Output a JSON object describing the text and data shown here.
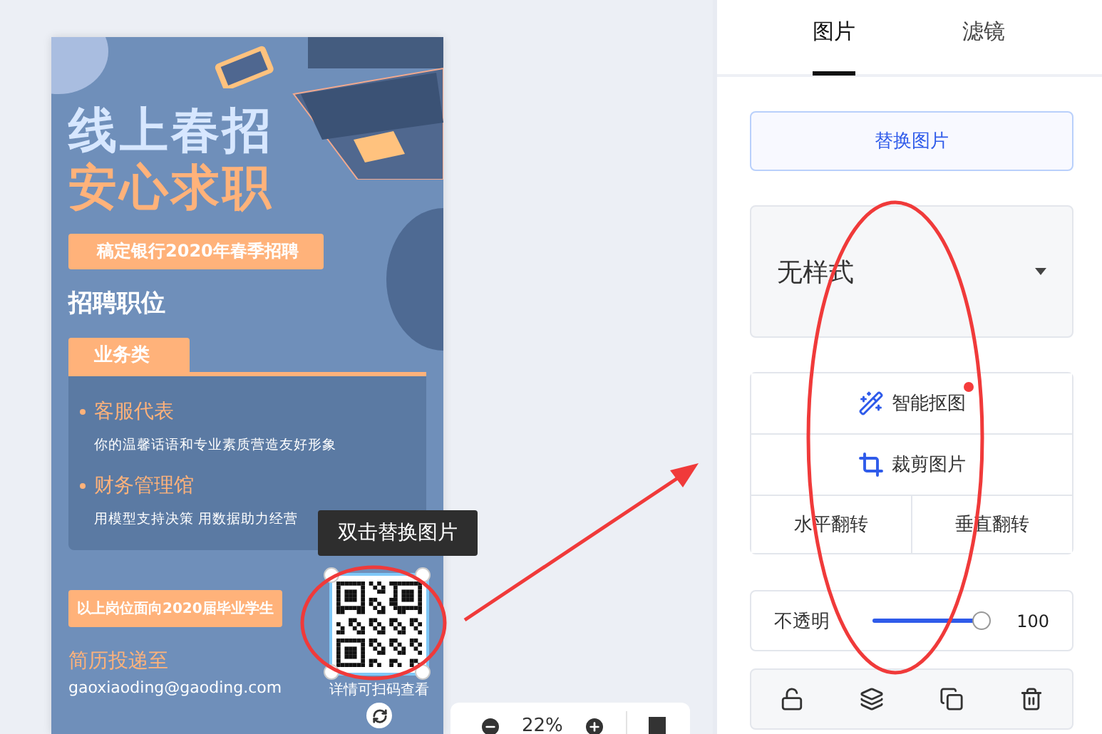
{
  "poster": {
    "headline": [
      "线上春招",
      "安心求职"
    ],
    "banner": "稿定银行2020年春季招聘",
    "section_title": "招聘职位",
    "category_tab": "业务类",
    "positions": [
      {
        "title": "客服代表",
        "description": "你的温馨话语和专业素质营造友好形象"
      },
      {
        "title": "财务管理馆",
        "description": "用模型支持决策 用数据助力经营"
      }
    ],
    "notice": "以上岗位面向2020届毕业学生",
    "contact_title": "简历投递至",
    "email": "gaoxiaoding@gaoding.com",
    "qr_caption": "详情可扫码查看"
  },
  "tooltip": "双击替换图片",
  "zoom_bar": {
    "value": "22%"
  },
  "panel": {
    "tabs": [
      {
        "label": "图片",
        "selected": true
      },
      {
        "label": "滤镜",
        "selected": false
      }
    ],
    "replace_button": "替换图片",
    "style_select": {
      "value": "无样式"
    },
    "tools": [
      {
        "kind": "cutout",
        "label": "智能抠图",
        "badge": true
      },
      {
        "kind": "crop",
        "label": "裁剪图片",
        "badge": false
      }
    ],
    "flip_buttons": [
      "水平翻转",
      "垂直翻转"
    ],
    "opacity": {
      "label": "不透明",
      "level": 1,
      "reading": "100"
    }
  }
}
